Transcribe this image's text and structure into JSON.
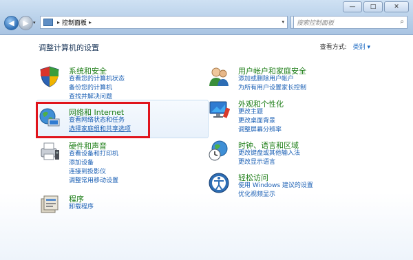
{
  "window": {
    "minimize_glyph": "—",
    "maximize_glyph": "□",
    "close_glyph": "✕"
  },
  "nav": {
    "back_glyph": "◀",
    "forward_glyph": "▶",
    "dropdown_glyph": "▾",
    "address_separator": "▸",
    "address_path": "控制面板",
    "address_trailing_separator": "▸",
    "refresh_glyph": "↻",
    "search_placeholder": "搜索控制面板",
    "search_icon_glyph": "⌕"
  },
  "content": {
    "title": "调整计算机的设置",
    "view_by_label": "查看方式:",
    "view_by_value": "类别 ▾"
  },
  "categories": [
    {
      "title": "系统和安全",
      "icon": "shield-icon",
      "links": [
        "查看您的计算机状态",
        "备份您的计算机",
        "查找并解决问题"
      ]
    },
    {
      "title": "网络和 Internet",
      "icon": "network-globe-icon",
      "links": [
        "查看网络状态和任务",
        "选择家庭组和共享选项"
      ]
    },
    {
      "title": "硬件和声音",
      "icon": "printer-icon",
      "links": [
        "查看设备和打印机",
        "添加设备",
        "连接到投影仪",
        "调整常用移动设置"
      ]
    },
    {
      "title": "程序",
      "icon": "programs-icon",
      "links": [
        "卸载程序"
      ]
    },
    {
      "title": "用户帐户和家庭安全",
      "icon": "users-icon",
      "links": [
        "添加或删除用户帐户",
        "为所有用户设置家长控制"
      ]
    },
    {
      "title": "外观和个性化",
      "icon": "monitor-icon",
      "links": [
        "更改主题",
        "更改桌面背景",
        "调整屏幕分辨率"
      ]
    },
    {
      "title": "时钟、语言和区域",
      "icon": "clock-globe-icon",
      "links": [
        "更改键盘或其他输入法",
        "更改显示语言"
      ]
    },
    {
      "title": "轻松访问",
      "icon": "ease-of-access-icon",
      "links": [
        "使用 Windows 建议的设置",
        "优化视频显示"
      ]
    }
  ],
  "colors": {
    "category_title": "#1c7d16",
    "link": "#1a5fb4",
    "highlight_frame": "#e0141c"
  }
}
